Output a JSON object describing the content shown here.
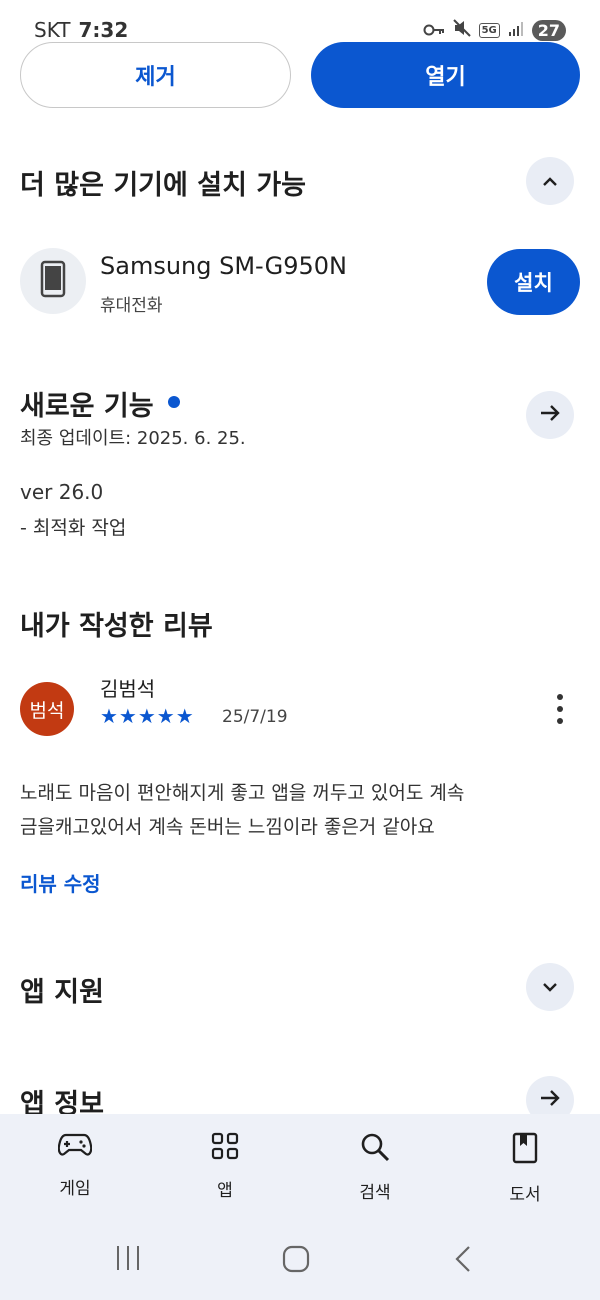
{
  "status_bar": {
    "carrier": "SKT",
    "time": "7:32",
    "network": "5G",
    "battery": "27"
  },
  "top_buttons": {
    "uninstall_label": "제거",
    "open_label": "열기"
  },
  "more_devices": {
    "title": "더 많은 기기에 설치 가능",
    "device_name": "Samsung SM-G950N",
    "device_type": "휴대전화",
    "install_label": "설치"
  },
  "whats_new": {
    "title": "새로운 기능",
    "last_updated": "최종 업데이트: 2025. 6. 25.",
    "version": "ver 26.0",
    "notes": "- 최적화 작업",
    "indicator_color": "#0b57d0"
  },
  "my_review": {
    "title": "내가 작성한 리뷰",
    "avatar_text": "범석",
    "reviewer": "김범석",
    "stars": "★★★★★",
    "rating": 5,
    "date": "25/7/19",
    "text_line1": "노래도 마음이 편안해지게 좋고 앱을 꺼두고 있어도 계속",
    "text_line2": "금을캐고있어서 계속 돈버는 느낌이라 좋은거 같아요",
    "edit_label": "리뷰 수정"
  },
  "app_support": {
    "title": "앱 지원"
  },
  "app_info": {
    "title": "앱 정보"
  },
  "bottom_nav": {
    "items": [
      {
        "label": "게임",
        "icon": "gamepad-icon"
      },
      {
        "label": "앱",
        "icon": "apps-grid-icon"
      },
      {
        "label": "검색",
        "icon": "search-icon"
      },
      {
        "label": "도서",
        "icon": "book-icon"
      }
    ]
  },
  "colors": {
    "accent": "#0b57d0",
    "avatar_bg": "#c23a12"
  }
}
